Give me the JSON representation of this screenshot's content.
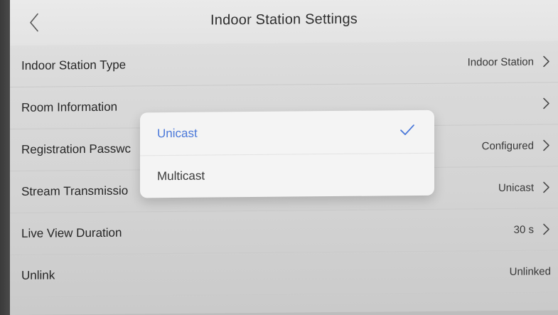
{
  "header": {
    "title": "Indoor Station Settings",
    "back_icon": "chevron-left-icon"
  },
  "settings": [
    {
      "label": "Indoor Station Type",
      "value": "Indoor Station"
    },
    {
      "label": "Room Information",
      "value": ""
    },
    {
      "label": "Registration Passwc",
      "value": "Configured"
    },
    {
      "label": "Stream Transmissio",
      "value": "Unicast"
    },
    {
      "label": "Live View Duration",
      "value": "30 s"
    },
    {
      "label": "Unlink",
      "value": "Unlinked"
    }
  ],
  "dialog": {
    "options": [
      {
        "label": "Unicast",
        "selected": true
      },
      {
        "label": "Multicast",
        "selected": false
      }
    ],
    "accent": "#4a78d9"
  }
}
